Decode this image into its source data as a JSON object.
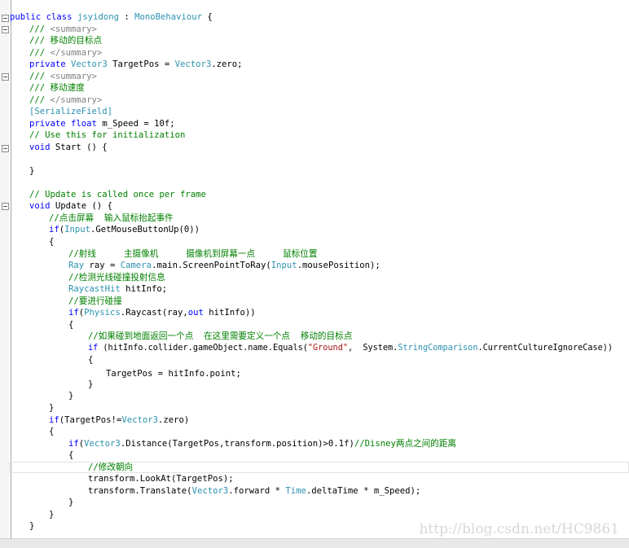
{
  "code": {
    "l01": {
      "kw1": "public",
      "kw2": "class",
      "name": "jsyidong",
      "sep": " : ",
      "base": "MonoBehaviour",
      "brace": " {"
    },
    "l02": {
      "doc1": "/// ",
      "tag": "<summary>"
    },
    "l03": {
      "doc1": "/// ",
      "text": "移动的目标点"
    },
    "l04": {
      "doc1": "/// ",
      "tag": "</summary>"
    },
    "l05": {
      "kw": "private",
      "type": "Vector3",
      "mid": " TargetPos = ",
      "type2": "Vector3",
      "tail": ".zero;"
    },
    "l06": {
      "doc1": "/// ",
      "tag": "<summary>"
    },
    "l07": {
      "doc1": "/// ",
      "text": "移动速度"
    },
    "l08": {
      "doc1": "/// ",
      "tag": "</summary>"
    },
    "l09": {
      "text": "[SerializeField]"
    },
    "l10": {
      "kw1": "private",
      "kw2": "float",
      "tail": " m_Speed = 10f;"
    },
    "l11": {
      "text": "// Use this for initialization"
    },
    "l12": {
      "kw": "void",
      "tail": " Start () {"
    },
    "l14": {
      "text": "}"
    },
    "l16": {
      "text": "// Update is called once per frame"
    },
    "l17": {
      "kw": "void",
      "tail": " Update () {"
    },
    "l18": {
      "text": "//点击屏幕  输入鼠标抬起事件"
    },
    "l19": {
      "kw": "if",
      "p1": "(",
      "type": "Input",
      "tail": ".GetMouseButtonUp(0))"
    },
    "l20": {
      "text": "{"
    },
    "l21": {
      "t1": "//射线",
      "t2": "主摄像机",
      "t3": "摄像机到屏幕一点",
      "t4": "鼠标位置"
    },
    "l22": {
      "type": "Ray",
      "mid": " ray = ",
      "type2": "Camera",
      "mid2": ".main.ScreenPointToRay(",
      "type3": "Input",
      "tail": ".mousePosition);"
    },
    "l23": {
      "text": "//检测光线碰撞投射信息"
    },
    "l24": {
      "type": "RaycastHit",
      "tail": " hitInfo;"
    },
    "l25": {
      "text": "//要进行碰撞"
    },
    "l26": {
      "kw": "if",
      "p1": "(",
      "type": "Physics",
      "mid": ".Raycast(ray,",
      "kw2": "out",
      "tail": " hitInfo))"
    },
    "l27": {
      "text": "{"
    },
    "l28": {
      "text": "//如果碰到地面返回一个点  在这里需要定义一个点  移动的目标点"
    },
    "l29": {
      "kw": "if",
      "mid": " (hitInfo.collider.gameObject.name.Equals(",
      "str": "\"Ground\"",
      "mid2": ",  System.",
      "type": "StringComparison",
      "tail": ".CurrentCultureIgnoreCase))"
    },
    "l30": {
      "text": "{"
    },
    "l31": {
      "text": "TargetPos = hitInfo.point;"
    },
    "l32": {
      "text": "}"
    },
    "l33": {
      "text": "}"
    },
    "l34": {
      "text": "}"
    },
    "l35": {
      "kw": "if",
      "mid": "(TargetPos!=",
      "type": "Vector3",
      "tail": ".zero)"
    },
    "l36": {
      "text": "{"
    },
    "l37": {
      "kw": "if",
      "p1": "(",
      "type": "Vector3",
      "mid": ".Distance(TargetPos,transform.position)>0.1f)",
      "cm": "//Disney两点之间的距离"
    },
    "l38": {
      "text": "{"
    },
    "l39": {
      "text": "//修改朝向"
    },
    "l40": {
      "text": "transform.LookAt(TargetPos);"
    },
    "l41": {
      "mid": "transform.Translate(",
      "type": "Vector3",
      "mid2": ".forward * ",
      "type2": "Time",
      "tail": ".deltaTime * m_Speed);"
    },
    "l42": {
      "text": "}"
    },
    "l43": {
      "text": "}"
    },
    "l44": {
      "text": "}"
    }
  },
  "watermark": "http://blog.csdn.net/HC9861",
  "colors": {
    "keyword": "#0000ff",
    "type": "#2b91af",
    "comment": "#008000",
    "doc": "#808080",
    "string": "#a31515"
  }
}
